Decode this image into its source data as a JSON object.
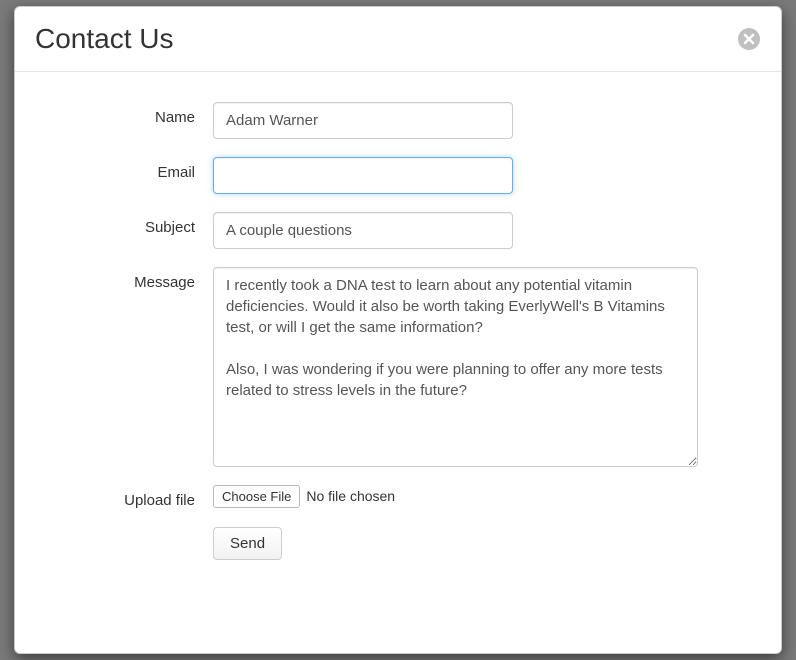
{
  "modal": {
    "title": "Contact Us"
  },
  "form": {
    "name": {
      "label": "Name",
      "value": "Adam Warner"
    },
    "email": {
      "label": "Email",
      "value": ""
    },
    "subject": {
      "label": "Subject",
      "value": "A couple questions"
    },
    "message": {
      "label": "Message",
      "value": "I recently took a DNA test to learn about any potential vitamin deficiencies. Would it also be worth taking EverlyWell's B Vitamins test, or will I get the same information?\n\nAlso, I was wondering if you were planning to offer any more tests related to stress levels in the future?"
    },
    "upload": {
      "label": "Upload file",
      "button": "Choose File",
      "status": "No file chosen"
    },
    "submit": {
      "label": "Send"
    }
  }
}
